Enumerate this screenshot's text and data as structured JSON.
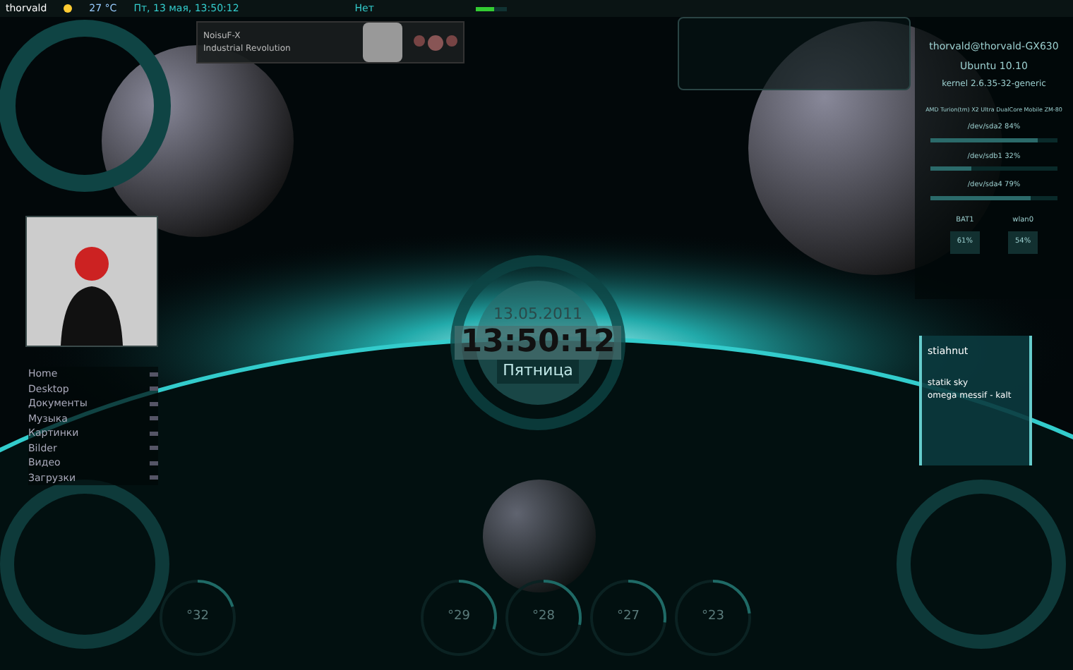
{
  "top_panel": {
    "user": "thorvald",
    "temperature": "27 °C",
    "datetime": "Пт, 13 мая, 13:50:12",
    "network": "Нет"
  },
  "player": {
    "artist": "NoisuF-X",
    "album": "Industrial Revolution"
  },
  "system": {
    "user_host": "thorvald@thorvald-GX630",
    "os": "Ubuntu 10.10",
    "kernel": "kernel 2.6.35-32-generic",
    "cpu": "AMD Turion(tm) X2 Ultra DualCore Mobile ZM-80",
    "disks": [
      {
        "label": "/dev/sda2 84%",
        "level": 0.84
      },
      {
        "label": "/dev/sdb1 32%",
        "level": 0.32
      },
      {
        "label": "/dev/sda4 79%",
        "level": 0.79
      }
    ],
    "meters": [
      {
        "label": "BAT1",
        "value": "61%"
      },
      {
        "label": "wlan0",
        "value": "54%"
      }
    ]
  },
  "clock": {
    "date": "13.05.2011",
    "time": "13:50:12",
    "weekday": "Пятница"
  },
  "places": [
    {
      "label": "Home"
    },
    {
      "label": "Desktop"
    },
    {
      "label": "Документы"
    },
    {
      "label": "Музыка"
    },
    {
      "label": "Картинки"
    },
    {
      "label": "Bilder"
    },
    {
      "label": "Видео"
    },
    {
      "label": "Загрузки"
    }
  ],
  "music": {
    "title": "stiahnut",
    "lines": [
      "statik sky",
      "omega messif - kalt"
    ]
  },
  "gauges": [
    {
      "value": "°32",
      "level": 0.2
    },
    {
      "value": "°29",
      "level": 0.3
    },
    {
      "value": "°28",
      "level": 0.28
    },
    {
      "value": "°27",
      "level": 0.27
    },
    {
      "value": "°23",
      "level": 0.23
    }
  ]
}
